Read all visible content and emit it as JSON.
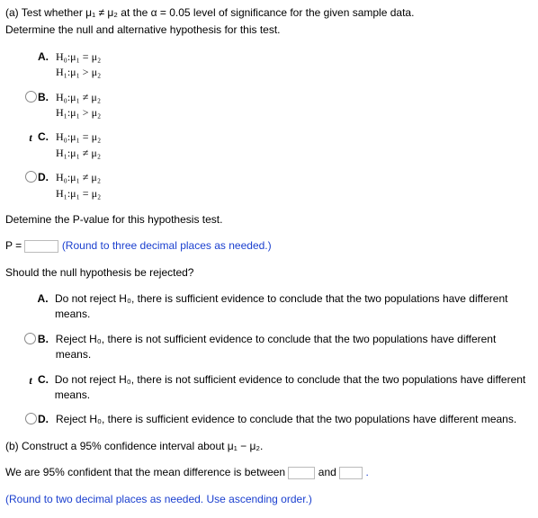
{
  "partA": {
    "intro1": "(a) Test whether μ₁ ≠ μ₂ at the α = 0.05 level of significance for the given sample data.",
    "intro2": "Determine the null and alternative hypothesis for this test.",
    "choices": {
      "A": {
        "letter": "A.",
        "line1": "H₀:μ₁ = μ₂",
        "line2": "H₁:μ₁ > μ₂"
      },
      "B": {
        "letter": "B.",
        "line1": "H₀:μ₁ ≠ μ₂",
        "line2": "H₁:μ₁ > μ₂"
      },
      "C": {
        "letter": "C.",
        "line1": "H₀:μ₁ = μ₂",
        "line2": "H₁:μ₁ ≠ μ₂"
      },
      "D": {
        "letter": "D.",
        "line1": "H₀:μ₁ ≠ μ₂",
        "line2": "H₁:μ₁ = μ₂"
      }
    }
  },
  "pvalue": {
    "prompt": "Detemine the P-value for this hypothesis test.",
    "prefix": "P = ",
    "hint": "(Round to three decimal places as needed.)"
  },
  "reject": {
    "prompt": "Should the null hypothesis be rejected?",
    "A": {
      "letter": "A.",
      "text": "Do not reject H₀, there is sufficient evidence to conclude that the two populations have different means."
    },
    "B": {
      "letter": "B.",
      "text": "Reject H₀, there is not sufficient evidence to conclude that the two populations have different means."
    },
    "C": {
      "letter": "C.",
      "text": "Do not reject H₀, there is not sufficient evidence to conclude that the two populations have different means."
    },
    "D": {
      "letter": "D.",
      "text": "Reject H₀, there is sufficient evidence to conclude that the two populations have different means."
    }
  },
  "partB": {
    "intro": "(b) Construct a 95% confidence interval about μ₁ − μ₂.",
    "line1a": "We are 95% confident that the mean difference is between ",
    "line1b": " and ",
    "period": ".",
    "hint": "(Round to two decimal places as needed. Use ascending order.)"
  },
  "checkmark": "t"
}
